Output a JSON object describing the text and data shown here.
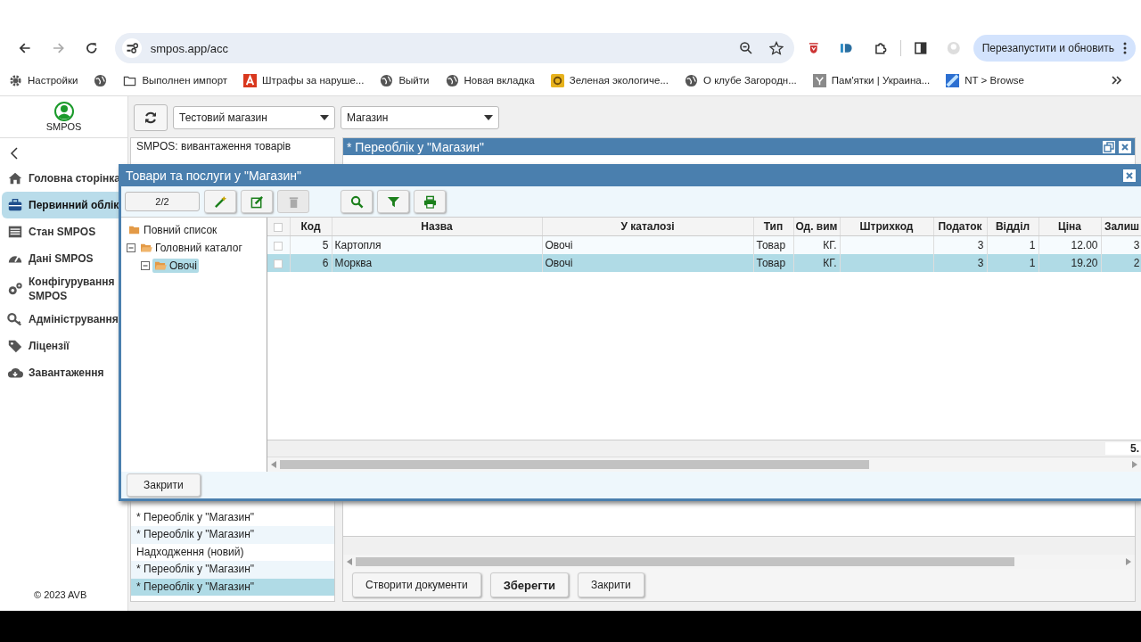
{
  "browser": {
    "url": "smpos.app/acc",
    "restart_button": "Перезапустити и обновить"
  },
  "bookmarks": [
    {
      "kind": "gear",
      "label": "Настройки"
    },
    {
      "kind": "globe"
    },
    {
      "kind": "folder",
      "label": "Выполнен импорт"
    },
    {
      "kind": "red",
      "label": "Штрафы за наруше..."
    },
    {
      "kind": "globe",
      "label": "Выйти"
    },
    {
      "kind": "globe",
      "label": "Новая вкладка"
    },
    {
      "kind": "yellow",
      "label": "Зеленая экологиче..."
    },
    {
      "kind": "globe",
      "label": "О клубе Загородн..."
    },
    {
      "kind": "grey",
      "label": "Пам'ятки | Украина..."
    },
    {
      "kind": "blue",
      "label": "NT > Browse"
    }
  ],
  "sidebar": {
    "logo": "SMPOS",
    "items": [
      {
        "label": "Головна сторінка",
        "selected": false
      },
      {
        "label": "Первинний облік",
        "selected": true
      },
      {
        "label": "Стан SMPOS",
        "selected": false
      },
      {
        "label": "Дані SMPOS",
        "selected": false
      },
      {
        "label": "Конфігурування SMPOS",
        "selected": false
      },
      {
        "label": "Адміністрування",
        "selected": false
      },
      {
        "label": "Ліцензії",
        "selected": false
      },
      {
        "label": "Завантаження",
        "selected": false
      }
    ],
    "footer": "© 2023 AVB"
  },
  "toolbar": {
    "store_select": "Тестовий магазин",
    "warehouse_select": "Магазин"
  },
  "documents": {
    "top_items": [
      {
        "label": "SMPOS: вивантаження товарів",
        "selected": false
      }
    ],
    "bottom_items": [
      {
        "label": "* Переоблік у \"Магазин\"",
        "selected": false
      },
      {
        "label": "* Переоблік у \"Магазин\"",
        "selected": false
      },
      {
        "label": "Надходження (новий)",
        "selected": false
      },
      {
        "label": "* Переоблік у \"Магазин\"",
        "selected": false
      },
      {
        "label": "* Переоблік у \"Магазин\"",
        "selected": true
      }
    ]
  },
  "document_panel": {
    "title": "* Переоблік у \"Магазин\"",
    "buttons": [
      {
        "label": "Створити документи",
        "default": false
      },
      {
        "label": "Зберегти",
        "default": true
      },
      {
        "label": "Закрити",
        "default": false
      }
    ]
  },
  "dialog": {
    "title": "Товари та послуги у \"Магазин\"",
    "counter": "2/2",
    "tools": [
      {
        "kind": "wand",
        "disabled": false
      },
      {
        "kind": "edit",
        "disabled": false
      },
      {
        "kind": "delete",
        "disabled": true
      },
      {
        "kind": "search",
        "disabled": false
      },
      {
        "kind": "filter",
        "disabled": false
      },
      {
        "kind": "print",
        "disabled": false
      }
    ],
    "tree": [
      {
        "label": "Повний список",
        "selected": false
      },
      {
        "label": "Головний каталог",
        "expanded": true,
        "selected": false,
        "children": [
          {
            "label": "Овочі",
            "expanded": true,
            "selected": true
          }
        ]
      }
    ],
    "columns": [
      "Код",
      "Назва",
      "У каталозі",
      "Тип",
      "Од. вим",
      "Штрихкод",
      "Податок",
      "Відділ",
      "Ціна",
      "Залиш"
    ],
    "all_checked": false,
    "rows": [
      {
        "selected": false,
        "checked": false,
        "cells": [
          "5",
          "Картопля",
          "Овочі",
          "Товар",
          "КГ.",
          "",
          "3",
          "1",
          "12.00",
          "3"
        ]
      },
      {
        "selected": true,
        "checked": false,
        "cells": [
          "6",
          "Морква",
          "Овочі",
          "Товар",
          "КГ.",
          "",
          "3",
          "1",
          "19.20",
          "2"
        ]
      }
    ],
    "total": "5.",
    "close_button": "Закрити"
  }
}
